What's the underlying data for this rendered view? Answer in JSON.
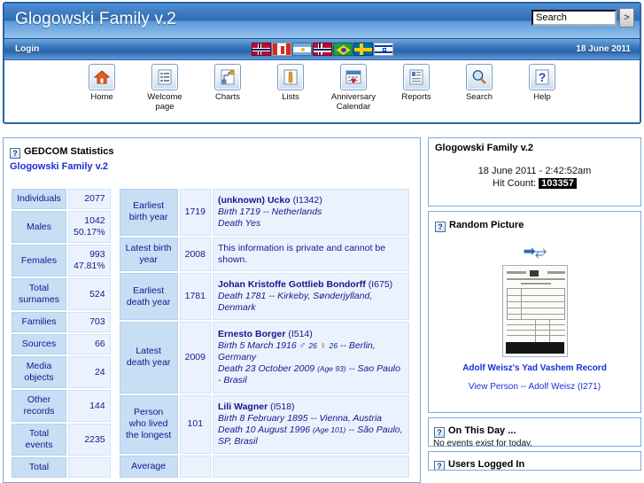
{
  "header": {
    "site_title": "Glogowski Family v.2",
    "search": {
      "value": "Search",
      "go_label": ">"
    },
    "login_label": "Login",
    "date_label": "18 June 2011",
    "flags": [
      {
        "name": "flag-norway",
        "title": "Norsk"
      },
      {
        "name": "flag-canada",
        "title": "English (Canada)"
      },
      {
        "name": "flag-argentina",
        "title": "Español"
      },
      {
        "name": "flag-iceland",
        "title": "Íslenska"
      },
      {
        "name": "flag-brazil",
        "title": "Português"
      },
      {
        "name": "flag-sweden",
        "title": "Svenska"
      },
      {
        "name": "flag-israel",
        "title": "עברית"
      }
    ],
    "nav": [
      {
        "label": "Home",
        "icon": "home-icon"
      },
      {
        "label": "Welcome page",
        "icon": "welcome-page-icon"
      },
      {
        "label": "Charts",
        "icon": "charts-icon"
      },
      {
        "label": "Lists",
        "icon": "lists-icon"
      },
      {
        "label": "Anniversary Calendar",
        "icon": "anniversary-calendar-icon"
      },
      {
        "label": "Reports",
        "icon": "reports-icon"
      },
      {
        "label": "Search",
        "icon": "search-icon"
      },
      {
        "label": "Help",
        "icon": "help-icon"
      }
    ]
  },
  "main": {
    "block_title": "GEDCOM Statistics",
    "gedcom_name": "Glogowski Family v.2",
    "counts": [
      {
        "label": "Individuals",
        "value": "2077",
        "pct": ""
      },
      {
        "label": "Males",
        "value": "1042",
        "pct": "50.17%"
      },
      {
        "label": "Females",
        "value": "993",
        "pct": "47.81%"
      },
      {
        "label": "Total surnames",
        "value": "524",
        "pct": ""
      },
      {
        "label": "Families",
        "value": "703",
        "pct": ""
      },
      {
        "label": "Sources",
        "value": "66",
        "pct": ""
      },
      {
        "label": "Media objects",
        "value": "24",
        "pct": ""
      },
      {
        "label": "Other records",
        "value": "144",
        "pct": ""
      },
      {
        "label": "Total events",
        "value": "2235",
        "pct": ""
      },
      {
        "label": "Total",
        "value": "",
        "pct": ""
      }
    ],
    "records": [
      {
        "label": "Earliest birth year",
        "year": "1719",
        "private": false,
        "person": "(unknown) Ucko",
        "pid": "(I1342)",
        "lines": [
          "Birth 1719 -- Netherlands",
          "Death Yes"
        ]
      },
      {
        "label": "Latest birth year",
        "year": "2008",
        "private": true,
        "private_text": "This information is private and cannot be shown.",
        "person": "",
        "pid": "",
        "lines": []
      },
      {
        "label": "Earliest death year",
        "year": "1781",
        "private": false,
        "person": "Johan Kristoffe Gottlieb Bondorff",
        "pid": "(I675)",
        "lines": [
          "Death 1781 -- Kirkeby, Sønderjylland, Denmark"
        ]
      },
      {
        "label": "Latest death year",
        "year": "2009",
        "private": false,
        "person": "Ernesto Borger",
        "pid": "(I514)",
        "lines": [
          "Birth 5 March 1916  ♂ 26  ♀ 26 -- Berlin, Germany",
          "Death 23 October 2009 (Age 93) -- Sao Paulo - Brasil"
        ]
      },
      {
        "label": "Person who lived the longest",
        "year": "101",
        "private": false,
        "person": "Lili Wagner",
        "pid": "(I518)",
        "lines": [
          "Birth 8 February 1895 -- Vienna, Austria",
          "Death 10 August 1996 (Age 101) -- São Paulo, SP, Brasil"
        ]
      },
      {
        "label": "Average",
        "year": "",
        "private": false,
        "person": "",
        "pid": "",
        "lines": []
      }
    ]
  },
  "sidebar": {
    "welcome": {
      "title": "Glogowski Family v.2",
      "clock": "18 June 2011 - 2:42:52am",
      "hit_label": "Hit Count:",
      "hit_count": "103357"
    },
    "random_picture": {
      "title": "Random Picture",
      "caption": "Adolf Weisz's Yad Vashem Record",
      "view_person": "View Person -- Adolf Weisz  (I271)"
    },
    "on_this_day": {
      "title": "On This Day ...",
      "text": "No events exist for today."
    },
    "users_logged_in": {
      "title": "Users Logged In"
    }
  },
  "colors": {
    "header_blue": "#2f6cb4",
    "link_blue": "#1c2fd6",
    "table_label_bg": "#c7def5",
    "table_value_bg": "#eaf3fd",
    "border_blue": "#7ea8d4"
  }
}
